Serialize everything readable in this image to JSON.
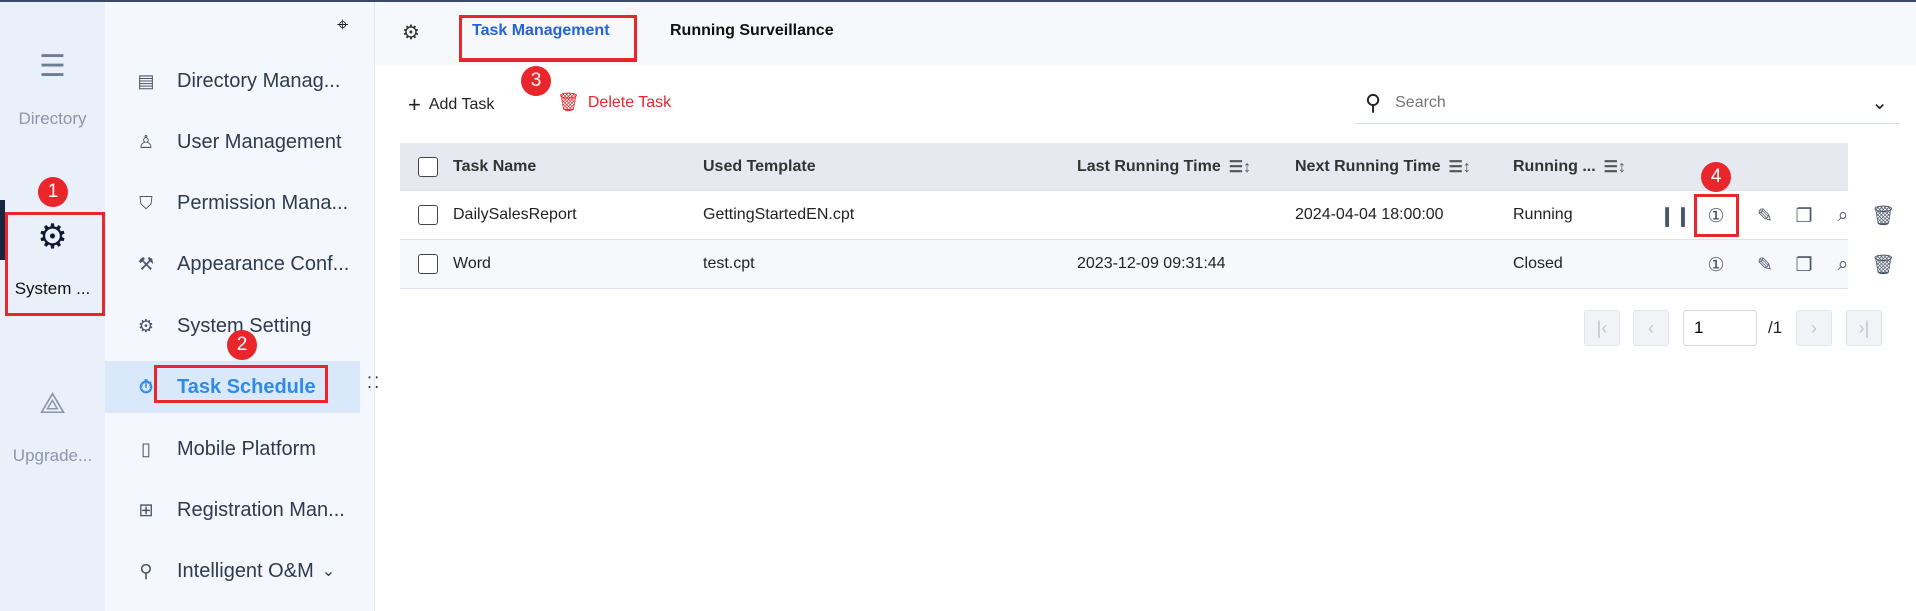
{
  "rail": [
    {
      "label": "Directory",
      "icon": "list-icon"
    },
    {
      "label": "System ...",
      "icon": "gear-icon"
    },
    {
      "label": "Upgrade...",
      "icon": "share-icon"
    }
  ],
  "menu": [
    {
      "label": "Directory Manag...",
      "icon": "list-box-icon"
    },
    {
      "label": "User Management",
      "icon": "user-list-icon"
    },
    {
      "label": "Permission Mana...",
      "icon": "shield-key-icon"
    },
    {
      "label": "Appearance Conf...",
      "icon": "paint-roller-icon"
    },
    {
      "label": "System Setting",
      "icon": "gear-icon"
    },
    {
      "label": "Task Schedule",
      "icon": "stopwatch-icon"
    },
    {
      "label": "Mobile Platform",
      "icon": "phone-icon"
    },
    {
      "label": "Registration Man...",
      "icon": "registration-icon"
    },
    {
      "label": "Intelligent O&M",
      "icon": "ops-icon"
    }
  ],
  "tabs": [
    {
      "label": "Task Management"
    },
    {
      "label": "Running Surveillance"
    }
  ],
  "toolbar": {
    "add": "Add Task",
    "delete": "Delete Task",
    "search_placeholder": "Search"
  },
  "table": {
    "headers": [
      "Task Name",
      "Used Template",
      "Last Running Time",
      "Next Running Time",
      "Running ..."
    ],
    "rows": [
      {
        "name": "DailySalesReport",
        "template": "GettingStartedEN.cpt",
        "last": "",
        "next": "2024-04-04 18:00:00",
        "status": "Running"
      },
      {
        "name": "Word",
        "template": "test.cpt",
        "last": "2023-12-09 09:31:44",
        "next": "",
        "status": "Closed"
      }
    ]
  },
  "pagination": {
    "page": "1",
    "total": "/1"
  },
  "badges": [
    "1",
    "2",
    "3",
    "4"
  ],
  "colors": {
    "accent": "#2462d6",
    "danger": "#e8262b",
    "active_menu": "#2f8ae8"
  }
}
